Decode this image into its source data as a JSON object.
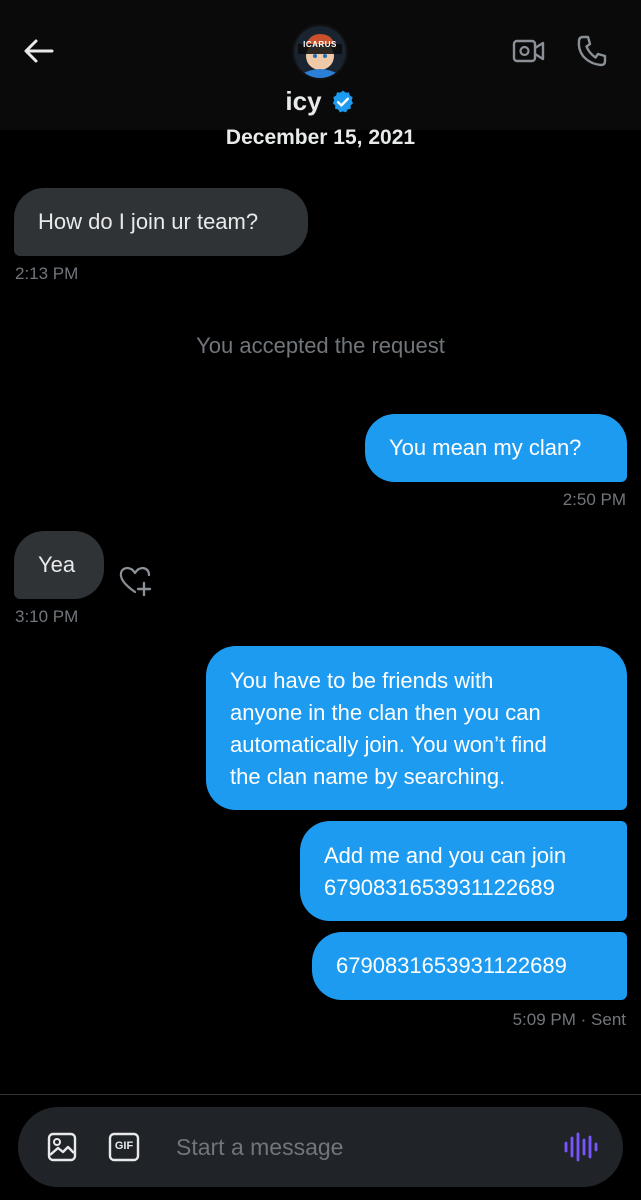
{
  "header": {
    "contact_name": "icy",
    "avatar_text": "ICARUS",
    "icons": [
      "back-arrow-icon",
      "verified-badge-icon",
      "video-call-icon",
      "phone-call-icon"
    ]
  },
  "conversation": {
    "date": "December 15, 2021",
    "system_notice": "You accepted the request",
    "messages": [
      {
        "direction": "in",
        "text": "How do I join ur team?",
        "time": "2:13 PM"
      },
      {
        "direction": "out",
        "text": "You mean my clan?",
        "time": "2:50 PM"
      },
      {
        "direction": "in",
        "text": "Yea",
        "time": "3:10 PM"
      },
      {
        "direction": "out",
        "lines": [
          "You have to be friends with",
          "anyone in the clan then you can",
          "automatically join. You won’t find",
          "the clan name by searching."
        ]
      },
      {
        "direction": "out",
        "lines": [
          "Add me and you can join",
          "6790831653931122689"
        ]
      },
      {
        "direction": "out",
        "text": "6790831653931122689",
        "time": "5:09 PM",
        "status": "· Sent"
      }
    ]
  },
  "composer": {
    "placeholder": "Start a message",
    "gif_label": "GIF",
    "icons": [
      "image-icon",
      "gif-icon",
      "voice-message-icon"
    ]
  },
  "colors": {
    "background": "#000000",
    "incoming_bubble": "#2f3336",
    "outgoing_bubble": "#1d9bf0",
    "muted_text": "#71767b",
    "voice_accent": "#7856ff",
    "verified": "#1d9bf0"
  }
}
